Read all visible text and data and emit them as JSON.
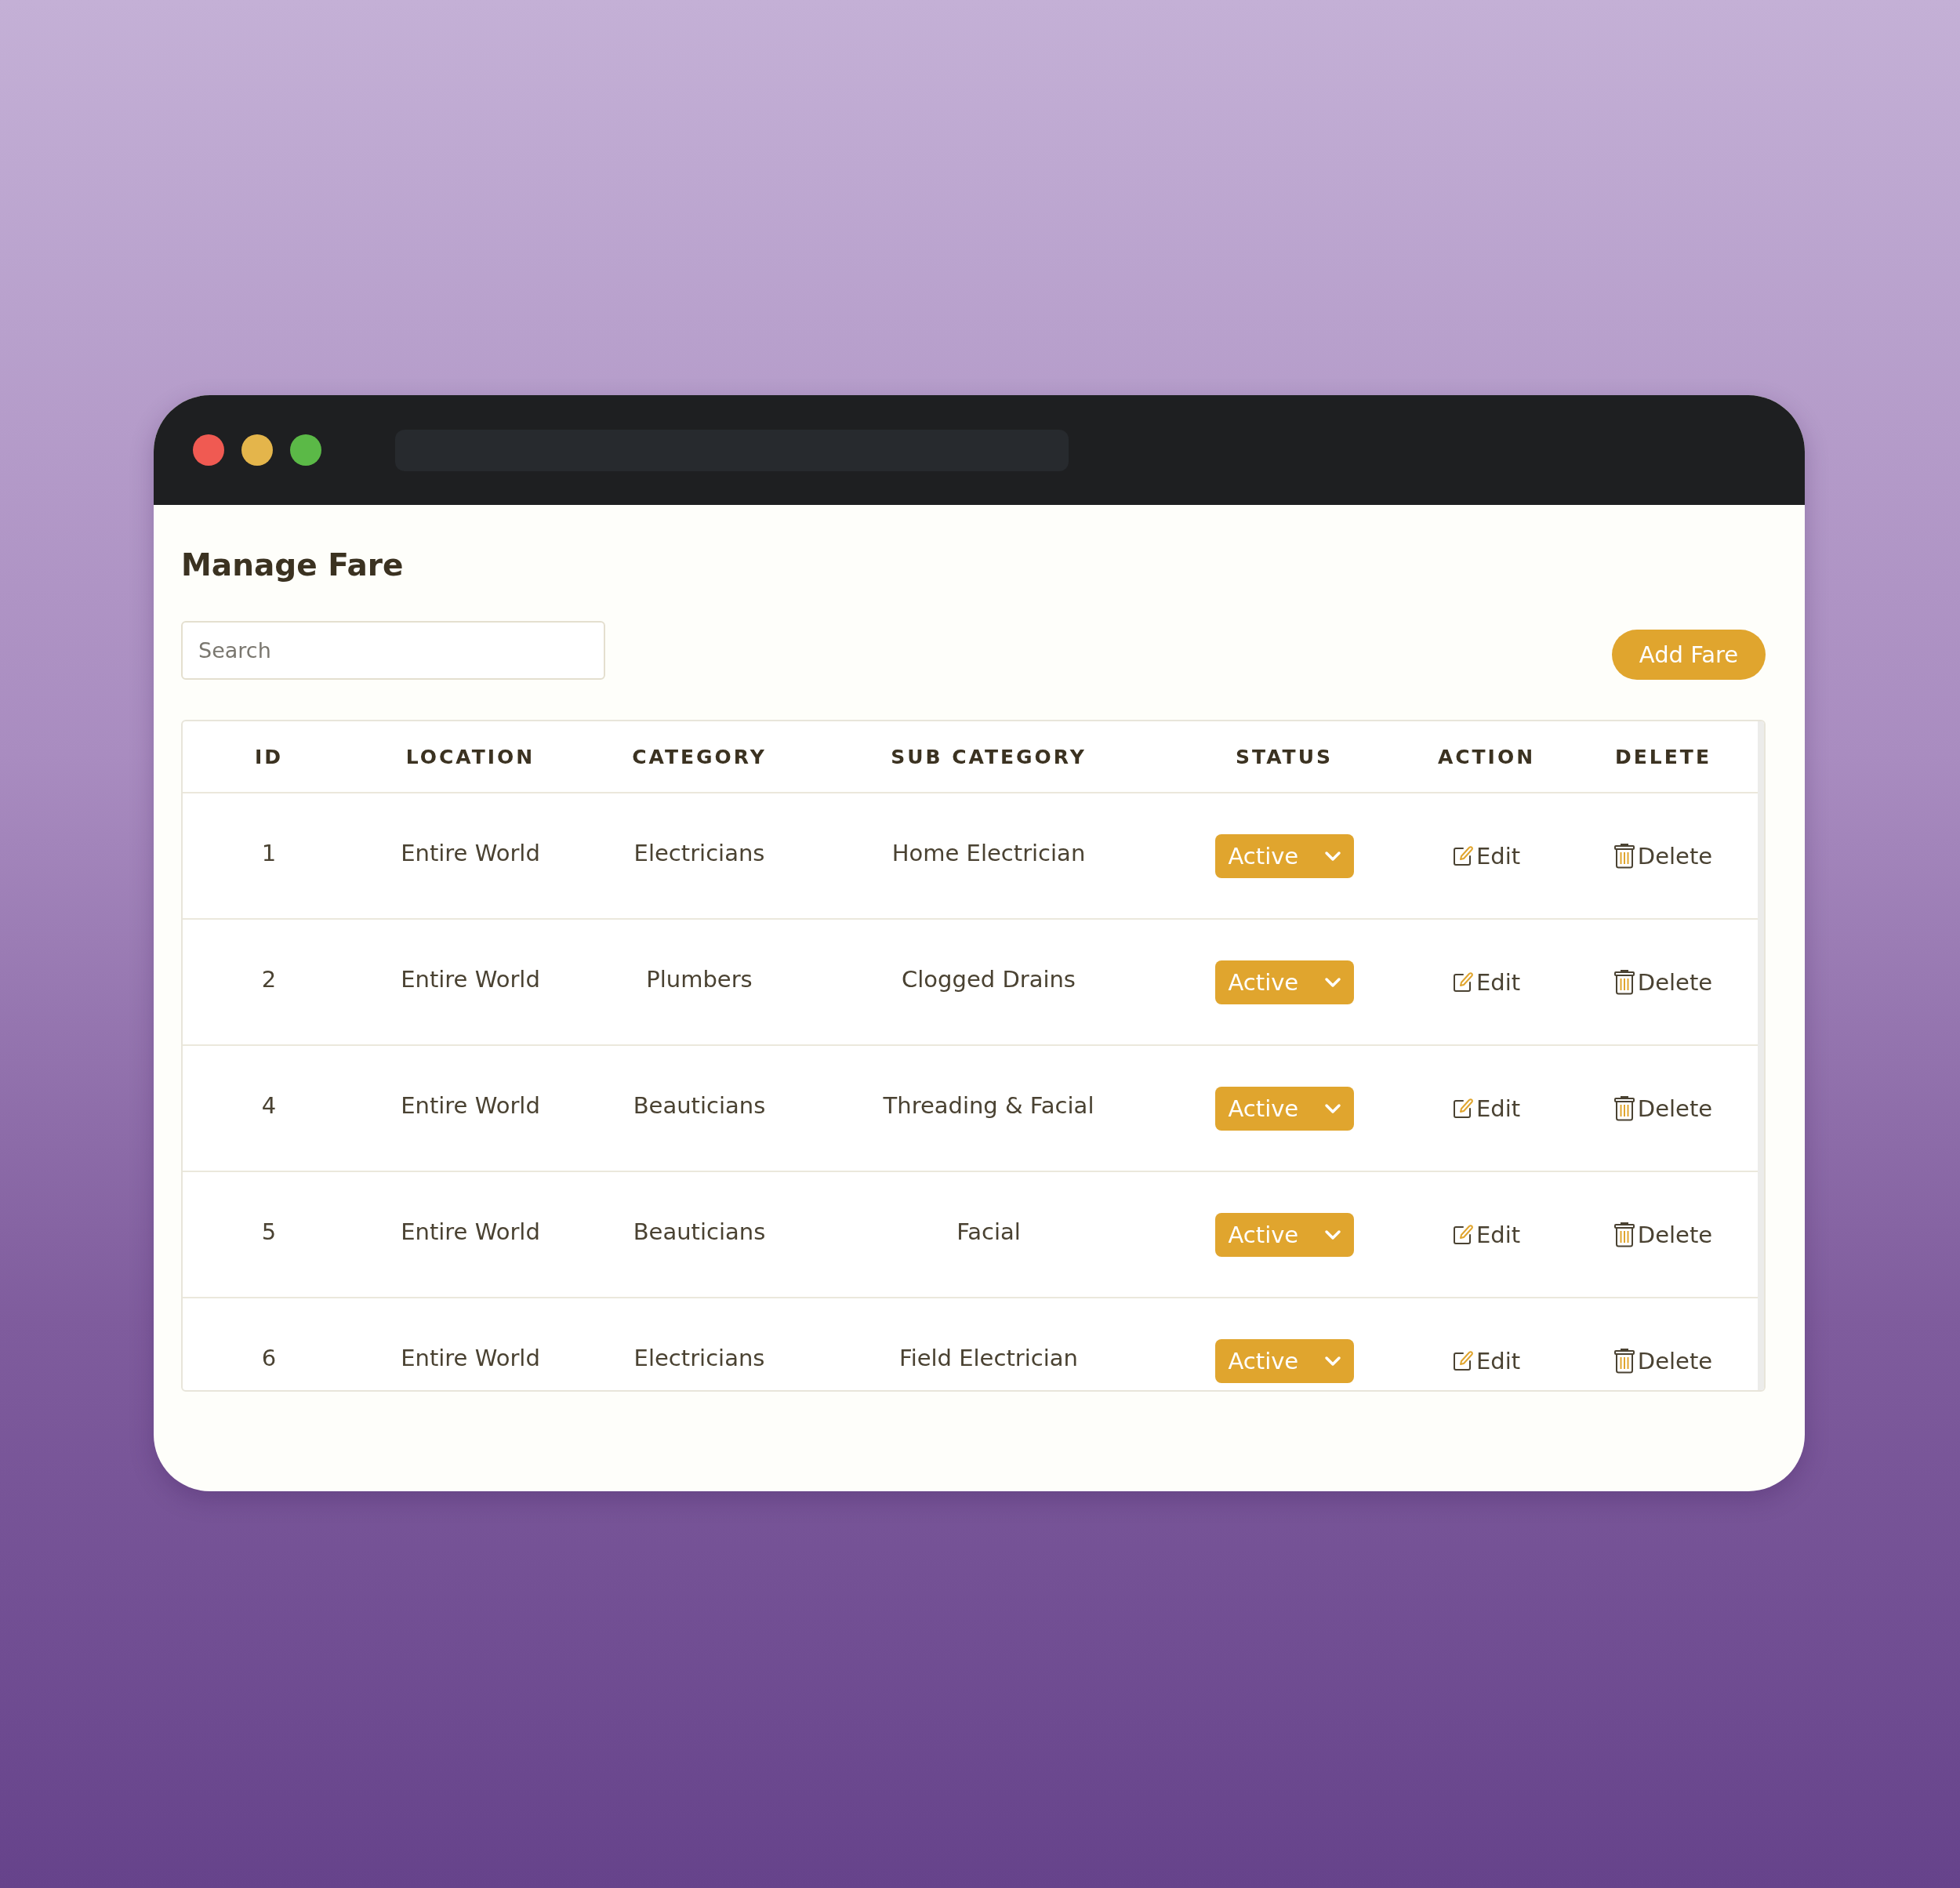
{
  "page": {
    "title": "Manage Fare"
  },
  "search": {
    "placeholder": "Search"
  },
  "add_button": {
    "label": "Add Fare"
  },
  "table": {
    "columns": [
      "ID",
      "LOCATION",
      "CATEGORY",
      "SUB CATEGORY",
      "STATUS",
      "ACTION",
      "DELETE"
    ],
    "rows": [
      {
        "id": "1",
        "location": "Entire World",
        "category": "Electricians",
        "sub_category": "Home Electrician",
        "status": "Active",
        "action": "Edit",
        "delete": "Delete"
      },
      {
        "id": "2",
        "location": "Entire World",
        "category": "Plumbers",
        "sub_category": "Clogged Drains",
        "status": "Active",
        "action": "Edit",
        "delete": "Delete"
      },
      {
        "id": "4",
        "location": "Entire World",
        "category": "Beauticians",
        "sub_category": "Threading & Facial",
        "status": "Active",
        "action": "Edit",
        "delete": "Delete"
      },
      {
        "id": "5",
        "location": "Entire World",
        "category": "Beauticians",
        "sub_category": "Facial",
        "status": "Active",
        "action": "Edit",
        "delete": "Delete"
      },
      {
        "id": "6",
        "location": "Entire World",
        "category": "Electricians",
        "sub_category": "Field Electrician",
        "status": "Active",
        "action": "Edit",
        "delete": "Delete"
      }
    ]
  }
}
